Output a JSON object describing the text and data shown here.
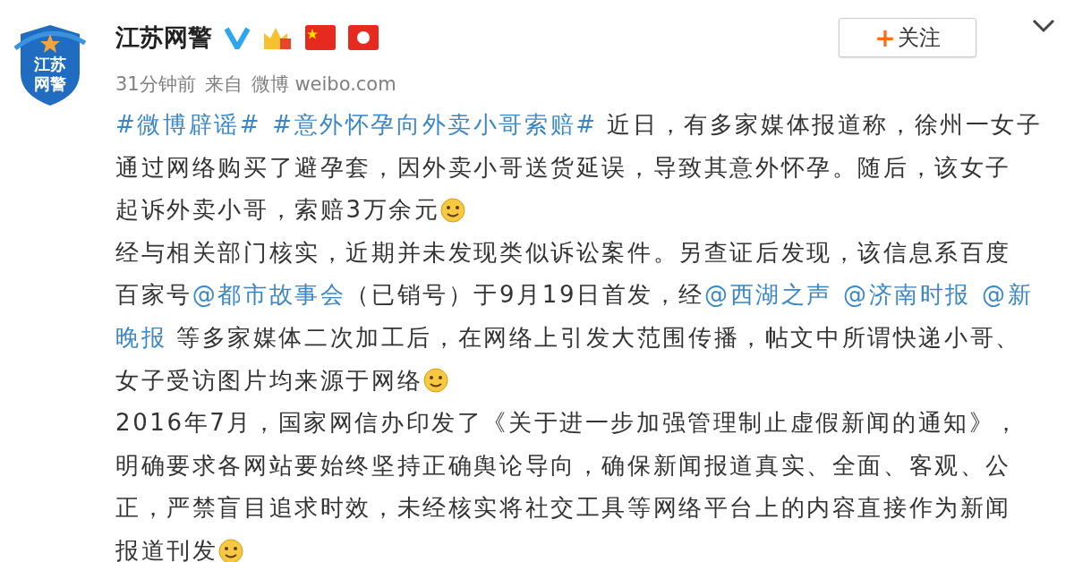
{
  "post": {
    "avatar_text": [
      "江苏",
      "网警"
    ],
    "author": "江苏网警",
    "time": "31分钟前",
    "source_prefix": "来自",
    "source": "微博 weibo.com",
    "follow_button": {
      "icon": "+",
      "label": "关注"
    },
    "lines": [
      [
        {
          "kind": "link",
          "text": "#微博辟谣#"
        },
        {
          "kind": "link",
          "text": "#意外怀孕向外卖小哥索赔#"
        },
        {
          "kind": "text",
          "text": " 近日，有多家媒体报道称，徐州一女子"
        }
      ],
      [
        {
          "kind": "text",
          "text": "通过网络购买了避孕套，因外卖小哥送货延误，导致其意外怀孕。随后，该女子"
        }
      ],
      [
        {
          "kind": "text",
          "text": "起诉外卖小哥，索赔3万余元"
        },
        {
          "kind": "emoji"
        }
      ],
      [
        {
          "kind": "text",
          "text": "经与相关部门核实，近期并未发现类似诉讼案件。另查证后发现，该信息系百度"
        }
      ],
      [
        {
          "kind": "text",
          "text": "百家号"
        },
        {
          "kind": "link",
          "text": "@都市故事会"
        },
        {
          "kind": "text",
          "text": "（已销号）于9月19日首发，经"
        },
        {
          "kind": "link",
          "text": "@西湖之声"
        },
        {
          "kind": "link",
          "text": "@济南时报"
        },
        {
          "kind": "link",
          "text": "@新"
        }
      ],
      [
        {
          "kind": "link",
          "text": "晚报"
        },
        {
          "kind": "text",
          "text": " 等多家媒体二次加工后，在网络上引发大范围传播，帖文中所谓快递小哥、"
        }
      ],
      [
        {
          "kind": "text",
          "text": "女子受访图片均来源于网络"
        },
        {
          "kind": "emoji"
        }
      ],
      [
        {
          "kind": "text",
          "text": "2016年7月，国家网信办印发了《关于进一步加强管理制止虚假新闻的通知》，"
        }
      ],
      [
        {
          "kind": "text",
          "text": "明确要求各网站要始终坚持正确舆论导向，确保新闻报道真实、全面、客观、公"
        }
      ],
      [
        {
          "kind": "text",
          "text": "正，严禁盲目追求时效，未经核实将社交工具等网络平台上的内容直接作为新闻"
        }
      ],
      [
        {
          "kind": "text",
          "text": "报道刊发"
        },
        {
          "kind": "emoji"
        }
      ]
    ]
  }
}
